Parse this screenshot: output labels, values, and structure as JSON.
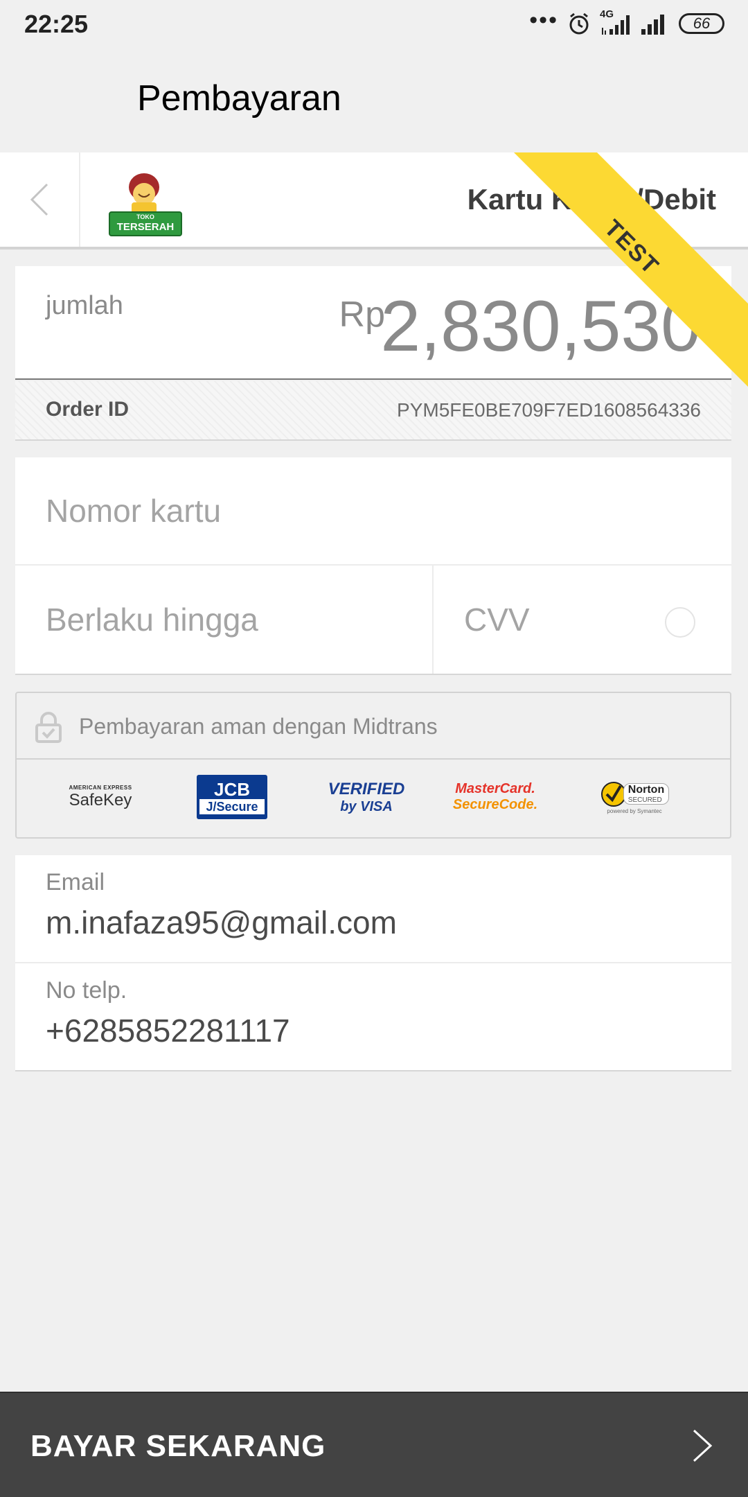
{
  "status_bar": {
    "time": "22:25",
    "dots": "•••",
    "network_type": "4G",
    "battery": "66"
  },
  "app_bar": {
    "title": "Pembayaran"
  },
  "merchant": {
    "logo_top_text": "TOKO",
    "logo_name": "TERSERAH",
    "payment_method": "Kartu Kredit/Debit",
    "ribbon": "TEST"
  },
  "amount": {
    "label": "jumlah",
    "currency": "Rp",
    "value": "2,830,530"
  },
  "order": {
    "label": "Order ID",
    "value": "PYM5FE0BE709F7ED1608564336"
  },
  "card_form": {
    "number_placeholder": "Nomor kartu",
    "expiry_placeholder": "Berlaku hingga",
    "cvv_placeholder": "CVV"
  },
  "security": {
    "text": "Pembayaran aman dengan Midtrans",
    "brands": {
      "amex_top": "AMERICAN EXPRESS",
      "amex_main": "SafeKey",
      "jcb_top": "JCB",
      "jcb_bottom": "J/Secure",
      "visa_top": "VERIFIED",
      "visa_bottom": "by VISA",
      "mc_top": "MasterCard.",
      "mc_bottom": "SecureCode.",
      "norton_main": "Norton",
      "norton_sub": "SECURED",
      "norton_foot": "powered by Symantec"
    }
  },
  "contact": {
    "email_label": "Email",
    "email_value": "m.inafaza95@gmail.com",
    "phone_label": "No telp.",
    "phone_value": "+6285852281117"
  },
  "footer": {
    "pay_label": "BAYAR SEKARANG"
  },
  "colors": {
    "background": "#f0f0f0",
    "ribbon": "#fcd933",
    "pay_button": "#434343",
    "jcb_blue": "#0b3a8f",
    "visa_blue": "#1a3f93",
    "mastercard_red": "#e5332a",
    "norton_yellow": "#f5c400"
  }
}
